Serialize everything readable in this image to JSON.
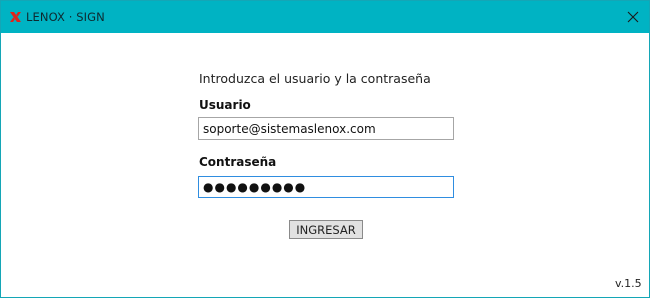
{
  "window": {
    "title": "LENOX · SIGN",
    "logo_icon": "lenox-x-logo-icon",
    "close_icon": "close-icon",
    "titlebar_color": "#00b3c3",
    "logo_color": "#e0241b"
  },
  "login": {
    "prompt": "Introduzca el usuario y la contraseña",
    "user_label": "Usuario",
    "user_value": "soporte@sistemaslenox.com",
    "password_label": "Contraseña",
    "password_value": "●●●●●●●●●",
    "submit_label": "INGRESAR",
    "focus_border_color": "#2f8de0"
  },
  "footer": {
    "version": "v.1.5"
  }
}
